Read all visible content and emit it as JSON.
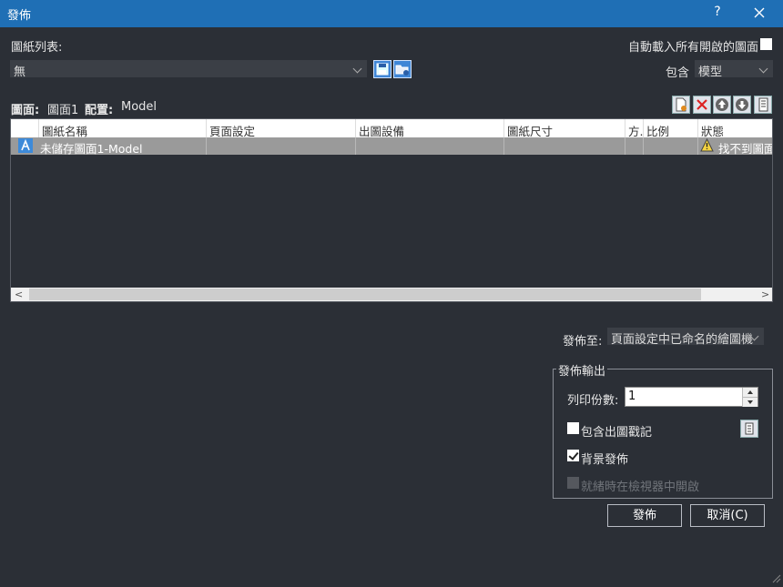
{
  "window": {
    "title": "發佈",
    "help_label": "?"
  },
  "sheet_list": {
    "label": "圖紙列表:",
    "selected": "無"
  },
  "auto_load": {
    "label": "自動載入所有開啟的圖面",
    "checked": false
  },
  "include": {
    "label": "包含",
    "selected": "模型"
  },
  "current": {
    "drawing_label": "圖面:",
    "drawing_value": "圖面1",
    "layout_label": "配置:",
    "layout_value": "Model"
  },
  "grid": {
    "columns": [
      "圖紙名稱",
      "頁面設定",
      "出圖設備",
      "圖紙尺寸",
      "方.",
      "比例",
      "狀態"
    ],
    "rows": [
      {
        "name": "未儲存圖面1-Model",
        "page_setup": "",
        "device": "",
        "size": "",
        "orientation": "",
        "scale": "",
        "status": "找不到圖面"
      }
    ]
  },
  "publish_to": {
    "label": "發佈至:",
    "selected": "頁面設定中已命名的繪圖機"
  },
  "output": {
    "title": "發佈輸出",
    "copies_label": "列印份數:",
    "copies_value": "1",
    "stamp_label": "包含出圖戳記",
    "stamp_checked": false,
    "background_label": "背景發佈",
    "background_checked": true,
    "viewer_label": "就緒時在檢視器中開啟",
    "viewer_checked": false
  },
  "buttons": {
    "publish": "發佈",
    "cancel": "取消(C)"
  },
  "colors": {
    "titlebar": "#1f6fb5",
    "background": "#2b2f36",
    "selected_row": "#9a9a9a"
  }
}
